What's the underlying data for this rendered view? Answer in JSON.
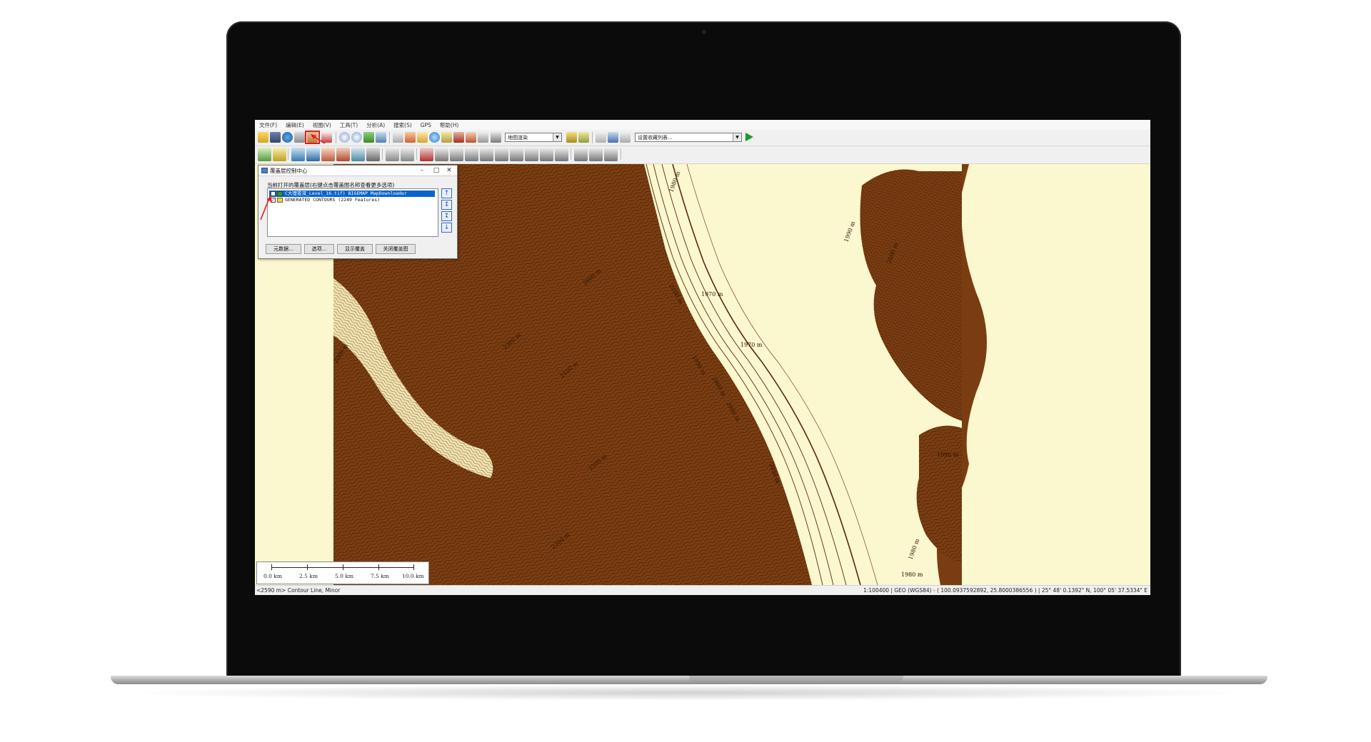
{
  "menu": [
    "文件(F)",
    "编辑(E)",
    "视图(V)",
    "工具(T)",
    "分析(A)",
    "搜索(S)",
    "GPS",
    "帮助(H)"
  ],
  "toolbar": {
    "map_style_combo": "地图渲染",
    "favorites_combo": "设置收藏列表..."
  },
  "dialog": {
    "title": "覆盖层控制中心",
    "list_label": "当前打开的覆盖层(右键点击覆盖图名称查看更多选项)",
    "layers": [
      {
        "name": "C大理苍洱_Level_16.tif) BIGEMAP MapDownloader",
        "checked": false,
        "selected": true
      },
      {
        "name": "GENERATED CONTOURS (2249 Features)",
        "checked": true,
        "selected": false
      }
    ],
    "buttons": {
      "metadata": "元数据...",
      "options": "选项...",
      "show_overlay": "显示覆盖",
      "close_overlay": "关闭覆盖图"
    },
    "move_arrows": [
      "↑",
      "↕",
      "↕",
      "↓"
    ]
  },
  "map": {
    "contour_labels": [
      "1980 m",
      "1970 m",
      "1990 m",
      "2000 m",
      "1970 m",
      "2000 m",
      "2050 m",
      "2100 m",
      "1990 m",
      "1980 m",
      "2100 m",
      "2600 m",
      "2300 m",
      "2500 m",
      "2000 m",
      "2200 m",
      "1990 m",
      "2000 m",
      "1980 m"
    ],
    "colors": {
      "land": "#7a3d12",
      "water": "#fbf7cf",
      "contour_line": "#4a2006"
    }
  },
  "scale_bar": {
    "ticks": [
      "0.0 km",
      "2.5 km",
      "5.0 km",
      "7.5 km",
      "10.0 km"
    ]
  },
  "status": {
    "feature": "<2590 m> Contour Line, Minor",
    "scale": "1:100400",
    "coords": "GEO (WGS84) - ( 100.0937592892, 25.8000386556 )",
    "dms": "25° 48' 0.1392\" N, 100° 05' 37.5334\" E"
  }
}
